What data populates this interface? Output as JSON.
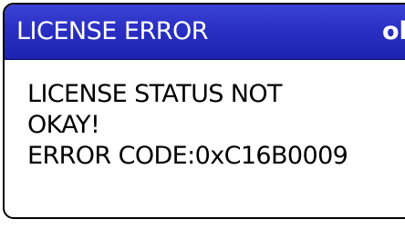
{
  "dialog": {
    "title": "LICENSE ERROR",
    "ok_label": "ok",
    "message_lines": [
      "LICENSE STATUS NOT",
      "OKAY!",
      "ERROR CODE:0xC16B0009"
    ]
  },
  "colors": {
    "titlebar": "#2a2fc4",
    "title_text": "#ffffff",
    "body_background": "#ffffff",
    "body_text": "#000000",
    "border": "#000000"
  }
}
